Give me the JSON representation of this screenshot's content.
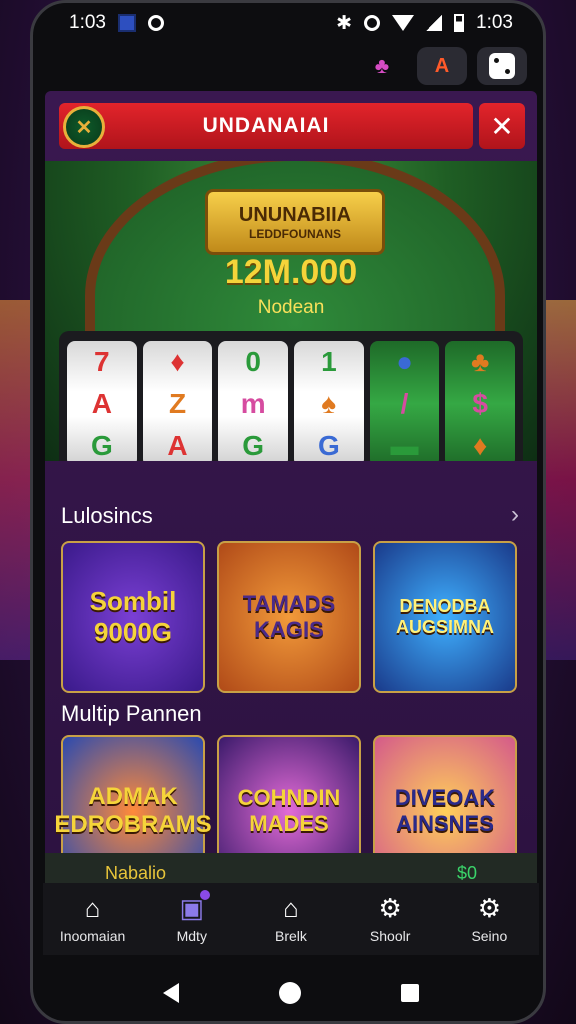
{
  "status_bar": {
    "time": "1:03",
    "battery_text": "1:03"
  },
  "header": {
    "title": "UNDANAIAI",
    "close_glyph": "✕",
    "logo_glyph": "✕"
  },
  "top_strip": {
    "badge_letter": "A"
  },
  "hero": {
    "banner_title": "UNUNABIIA",
    "banner_subtitle": "LEDDFOUNANS",
    "jackpot_value": "12M.000",
    "jackpot_label": "Nodean"
  },
  "reels": [
    [
      "7",
      "A",
      "G"
    ],
    [
      "♦",
      "Z",
      "A"
    ],
    [
      "0",
      "m",
      "G"
    ],
    [
      "1",
      "♠",
      "G"
    ],
    [
      "●",
      "/",
      "▬"
    ],
    [
      "♣",
      "$",
      "♦"
    ]
  ],
  "section1": {
    "title": "Lulosincs",
    "chevron": "›",
    "tiles": [
      "Sombil 9000G",
      "TAMADS KAGIS",
      "DENODBA AUGSIMNA"
    ]
  },
  "section2": {
    "title": "Multip Pannen",
    "tiles": [
      "ADMAK EDROBRAMS",
      "COHNDIN MADES",
      "DIVEOAK AINSNES"
    ]
  },
  "peek_bar": {
    "left": "Nabalio",
    "right": "$0"
  },
  "bottom_nav": [
    {
      "label": "Inoomaian",
      "icon": "home-icon",
      "glyph": "⌂"
    },
    {
      "label": "Mdty",
      "icon": "cards-icon",
      "glyph": "▣"
    },
    {
      "label": "Brelk",
      "icon": "house-outline-icon",
      "glyph": "⌂"
    },
    {
      "label": "Shoolr",
      "icon": "gear-group-icon",
      "glyph": "⚙"
    },
    {
      "label": "Seino",
      "icon": "settings-icon",
      "glyph": "⚙"
    }
  ],
  "colors": {
    "accent": "#e3242b",
    "gold": "#f5d43a",
    "felt": "#2f8a3a"
  }
}
